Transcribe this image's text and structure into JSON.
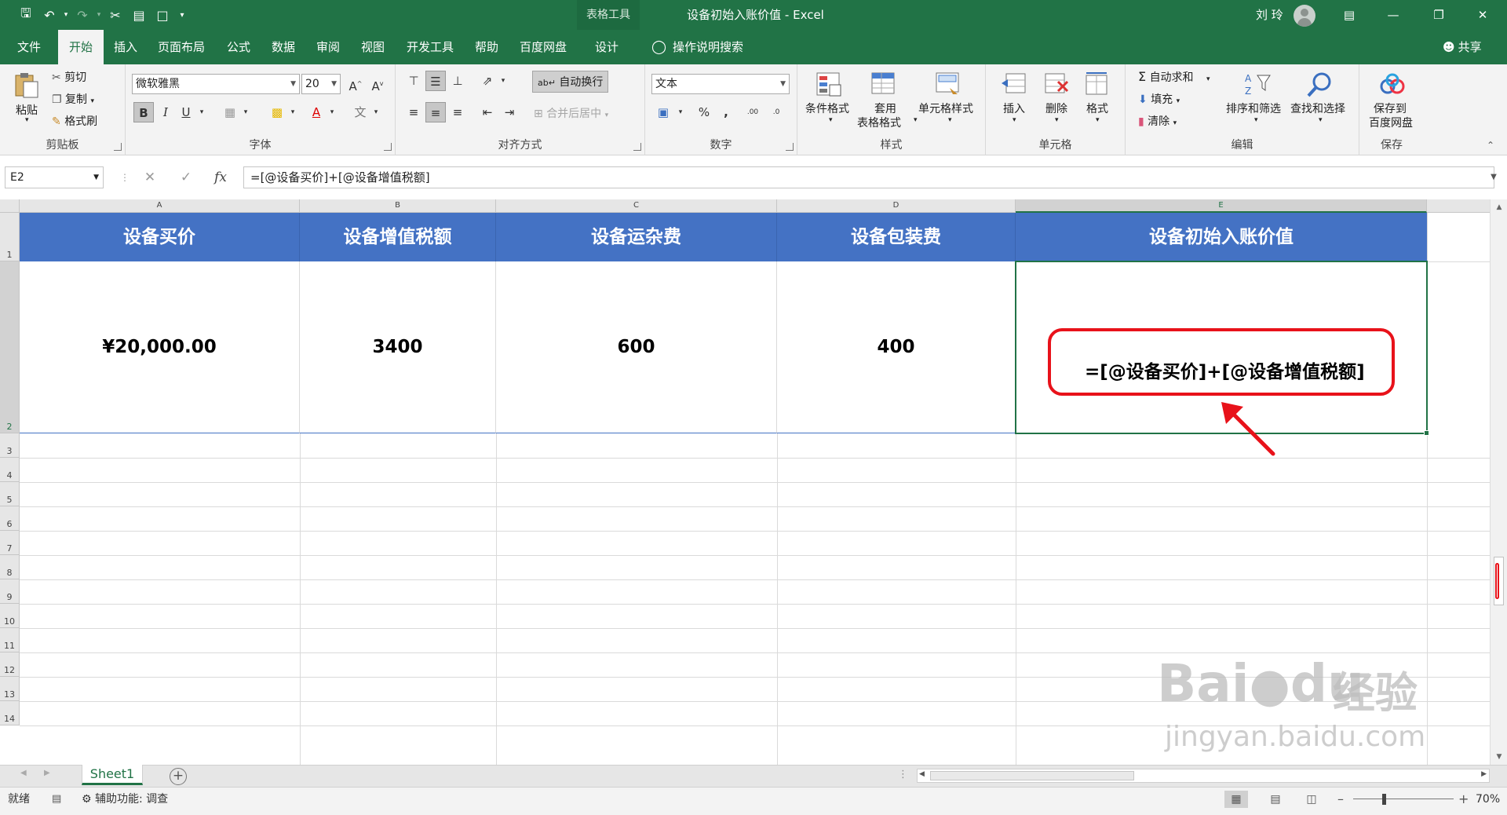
{
  "titlebar": {
    "context_tab": "表格工具",
    "document_title": "设备初始入账价值 - Excel",
    "user_name": "刘 玲",
    "theme_color": "#217346"
  },
  "ribbon_tabs": {
    "file": "文件",
    "home": "开始",
    "insert": "插入",
    "page_layout": "页面布局",
    "formulas": "公式",
    "data": "数据",
    "review": "审阅",
    "view": "视图",
    "developer": "开发工具",
    "help": "帮助",
    "baidu_disk": "百度网盘",
    "design": "设计",
    "tell_me": "操作说明搜索",
    "share": "共享"
  },
  "ribbon": {
    "clipboard": {
      "paste": "粘贴",
      "cut": "剪切",
      "copy": "复制",
      "format_painter": "格式刷",
      "label": "剪贴板"
    },
    "font": {
      "font_name": "微软雅黑",
      "font_size": "20",
      "label": "字体"
    },
    "alignment": {
      "wrap_text": "自动换行",
      "merge_center": "合并后居中",
      "label": "对齐方式"
    },
    "number": {
      "format": "文本",
      "label": "数字"
    },
    "styles": {
      "conditional": "条件格式",
      "table_format_1": "套用",
      "table_format_2": "表格格式",
      "cell_styles": "单元格样式",
      "label": "样式"
    },
    "cells": {
      "insert": "插入",
      "delete": "删除",
      "format": "格式",
      "label": "单元格"
    },
    "editing": {
      "autosum": "自动求和",
      "fill": "填充",
      "clear": "清除",
      "sort_filter": "排序和筛选",
      "find_select": "查找和选择",
      "label": "编辑"
    },
    "save": {
      "save_to_1": "保存到",
      "save_to_2": "百度网盘",
      "label": "保存"
    }
  },
  "formula_bar": {
    "name_box": "E2",
    "formula": "=[@设备买价]+[@设备增值税额]"
  },
  "grid": {
    "columns": [
      "A",
      "B",
      "C",
      "D",
      "E"
    ],
    "rows": [
      "1",
      "2",
      "3",
      "4",
      "5",
      "6",
      "7",
      "8",
      "9",
      "10",
      "11",
      "12",
      "13",
      "14"
    ],
    "headers": [
      "设备买价",
      "设备增值税额",
      "设备运杂费",
      "设备包装费",
      "设备初始入账价值"
    ],
    "values": [
      "¥20,000.00",
      "3400",
      "600",
      "400"
    ],
    "e2_formula_display": "=[@设备买价]+[@设备增值税额]",
    "header_fill": "#4472c4",
    "highlight_color": "#e8121a"
  },
  "sheets": {
    "active": "Sheet1"
  },
  "statusbar": {
    "mode": "就绪",
    "accessibility": "辅助功能: 调查",
    "zoom": "70%"
  },
  "watermark": {
    "brand": "Bai",
    "brand2": "du",
    "cn": "经验",
    "url": "jingyan.baidu.com"
  }
}
